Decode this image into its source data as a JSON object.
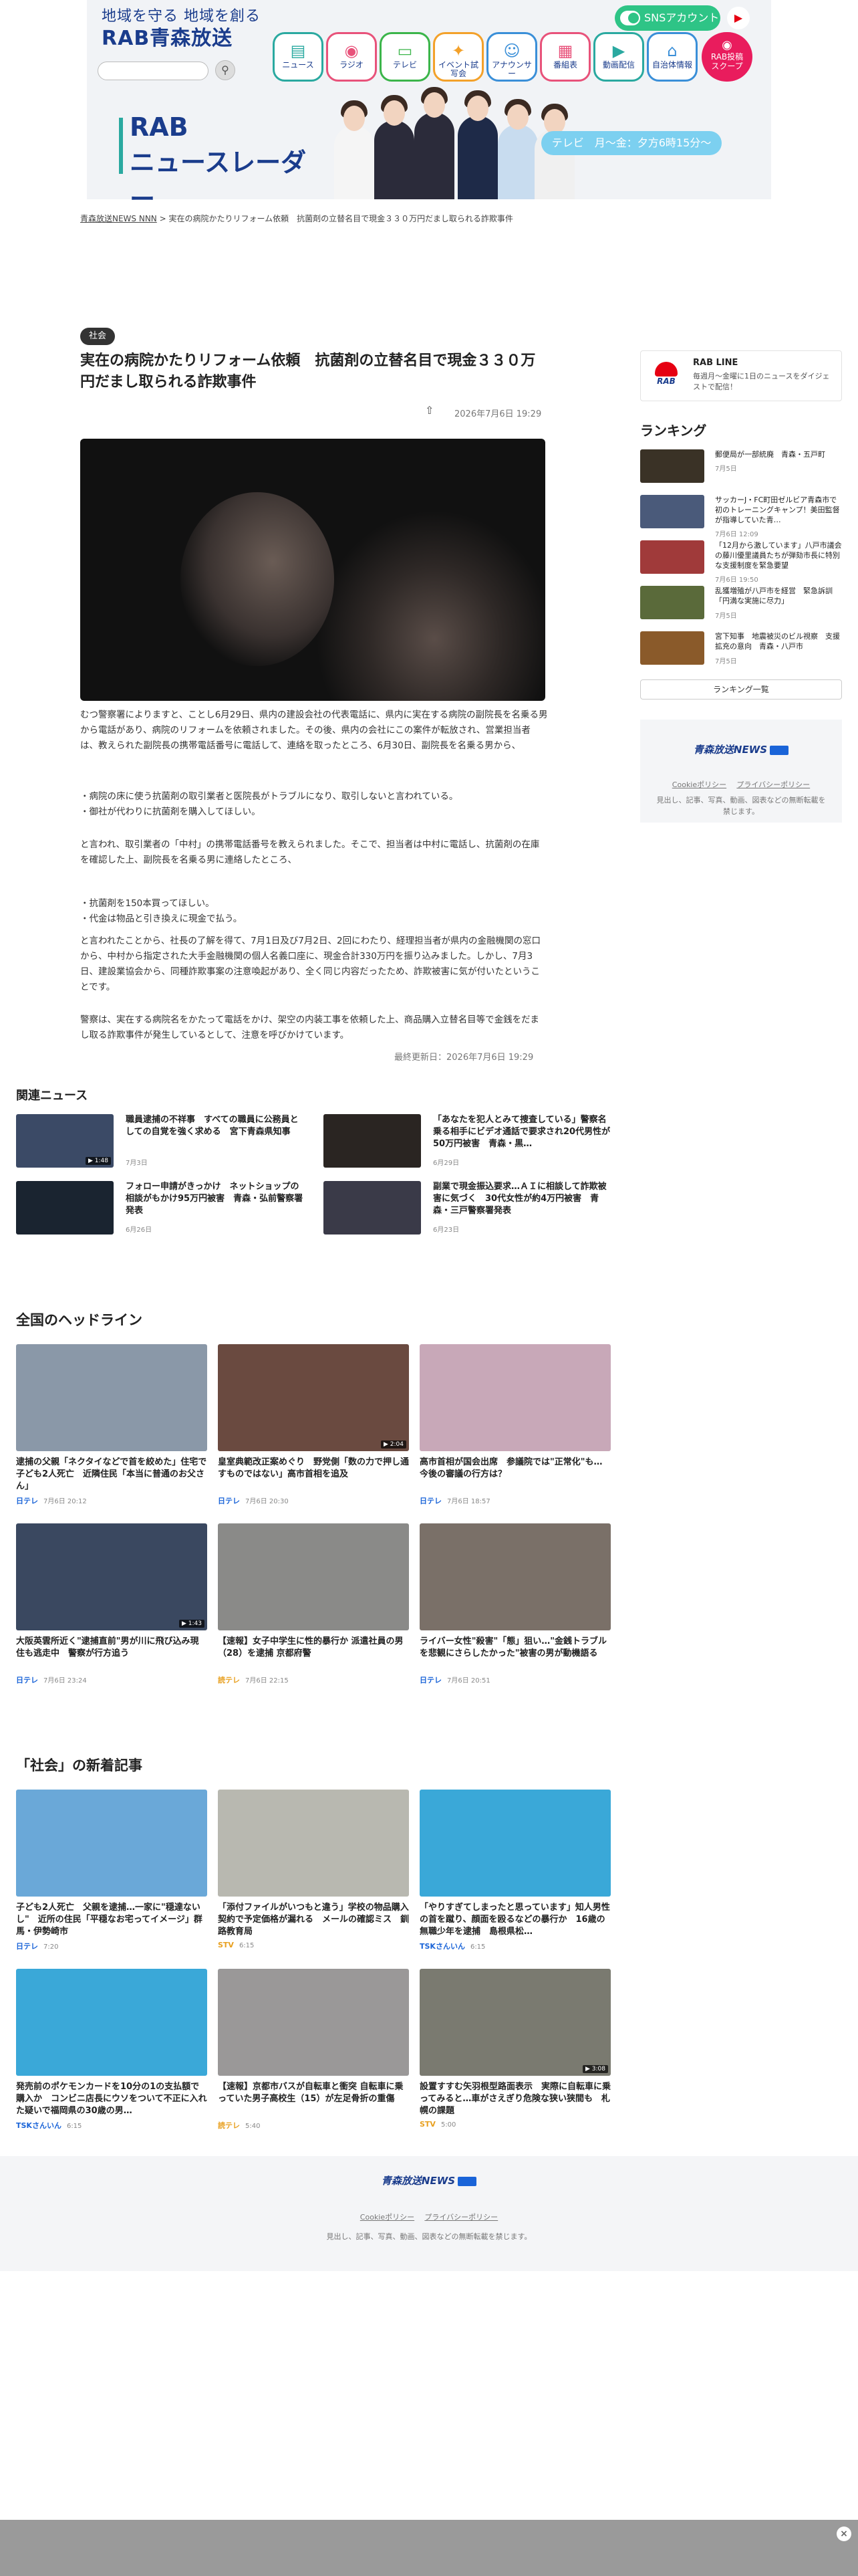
{
  "header": {
    "tagline": "地域を守る 地域を創る",
    "brand": "RAB青森放送",
    "sns_label": "SNSアカウント",
    "nav": [
      {
        "label": "ニュース",
        "icon": "newspaper-icon",
        "color": "#2aa9a0"
      },
      {
        "label": "ラジオ",
        "icon": "radio-icon",
        "color": "#e8527a"
      },
      {
        "label": "テレビ",
        "icon": "tv-icon",
        "color": "#3bb54a"
      },
      {
        "label": "イベント試写会",
        "icon": "ticket-icon",
        "color": "#f3a12a"
      },
      {
        "label": "アナウンサー",
        "icon": "announcer-icon",
        "color": "#3a8fd8"
      },
      {
        "label": "番組表",
        "icon": "calendar-icon",
        "color": "#e8527a"
      },
      {
        "label": "動画配信",
        "icon": "video-icon",
        "color": "#2aa9a0"
      },
      {
        "label": "自治体情報",
        "icon": "building-icon",
        "color": "#3a8fd8"
      }
    ],
    "scoop_label": "RAB投稿スクープ",
    "banner_line1": "RAB",
    "banner_line2": "ニュースレーダー",
    "onair": "テレビ　月〜金：夕方6時15分〜"
  },
  "breadcrumb": {
    "home": "青森放送NEWS NNN",
    "current": "実在の病院かたりリフォーム依頼　抗菌剤の立替名目で現金３３０万円だまし取られる詐欺事件"
  },
  "article": {
    "category": "社会",
    "title": "実在の病院かたりリフォーム依頼　抗菌剤の立替名目で現金３３０万円だまし取られる詐欺事件",
    "date": "2026年7月6日 19:29",
    "paragraphs": [
      "むつ警察署によりますと、ことし6月29日、県内の建設会社の代表電話に、県内に実在する病院の副院長を名乗る男から電話があり、病院のリフォームを依頼されました。その後、県内の会社にこの案件が転放され、営業担当者は、教えられた副院長の携帯電話番号に電話して、連絡を取ったところ、6月30日、副院長を名乗る男から、",
      "・病院の床に使う抗菌剤の取引業者と医院長がトラブルになり、取引しないと言われている。\n・御社が代わりに抗菌剤を購入してほしい。",
      "と言われ、取引業者の「中村」の携帯電話番号を教えられました。そこで、担当者は中村に電話し、抗菌剤の在庫を確認した上、副院長を名乗る男に連絡したところ、",
      "・抗菌剤を150本買ってほしい。\n・代金は物品と引き換えに現金で払う。",
      "と言われたことから、社長の了解を得て、7月1日及び7月2日、2回にわたり、経理担当者が県内の金融機関の窓口から、中村から指定された大手金融機関の個人名義口座に、現金合計330万円を振り込みました。しかし、7月3日、建設業協会から、同種詐欺事案の注意喚起があり、全く同じ内容だったため、詐欺被害に気が付いたということです。",
      "警察は、実在する病院名をかたって電話をかけ、架空の内装工事を依頼した上、商品購入立替名目等で金銭をだまし取る詐欺事件が発生しているとして、注意を呼びかけています。"
    ],
    "updated": "最終更新日：2026年7月6日 19:29"
  },
  "sidebar": {
    "line_title": "RAB LINE",
    "line_desc": "毎週月〜金曜に1日のニュースをダイジェストで配信！",
    "ranking_title": "ランキング",
    "ranking": [
      {
        "title": "郵便局が一部統廃　青森・五戸町",
        "date": "7月5日",
        "color": "#3a3226"
      },
      {
        "title": "サッカーJ・FC町田ゼルビア青森市で初のトレーニングキャンプ！美田監督が指導していた青…",
        "date": "7月6日 12:09",
        "color": "#4a5a7a"
      },
      {
        "title": "「12月から激しています」八戸市議会の藤川優里議員たちが弾劾市長に特別な支援制度を緊急要望",
        "date": "7月6日 19:50",
        "color": "#a03a3a"
      },
      {
        "title": "乱獲増殖が八戸市を経営　緊急訴訓「円満な実施に尽力」",
        "date": "7月5日",
        "color": "#5a6a3a"
      },
      {
        "title": "宮下知事　地震被災のビル視察　支援拡充の意向　青森・八戸市",
        "date": "7月5日",
        "color": "#8a5a2a"
      }
    ],
    "ranking_more": "ランキング一覧",
    "foot_brand": "青森放送NEWS",
    "cookie": "Cookieポリシー",
    "privacy": "プライバシーポリシー",
    "copyright": "見出し、記事、写真、動画、図表などの無断転載を禁じます。"
  },
  "related": {
    "title": "関連ニュース",
    "items": [
      {
        "title": "職員逮捕の不祥事　すべての職員に公務員としての自覚を強く求める　宮下青森県知事",
        "date": "7月3日",
        "color": "#3b4a66",
        "video": "▶ 1:48"
      },
      {
        "title": "「あなたを犯人とみて捜査している」警察名乗る相手にビデオ通話で要求され20代男性が50万円被害　青森・黒…",
        "date": "6月29日",
        "color": "#2a2522",
        "video": ""
      },
      {
        "title": "フォロー申請がきっかけ　ネットショップの相談がもかけ95万円被害　青森・弘前警察署発表",
        "date": "6月26日",
        "color": "#1a2430",
        "video": ""
      },
      {
        "title": "副業で現金振込要求…ＡＩに相談して詐欺被害に気づく　30代女性が約4万円被害　青森・三戸警察署発表",
        "date": "6月23日",
        "color": "#3a3a48",
        "video": ""
      }
    ]
  },
  "national": {
    "title": "全国のヘッドライン",
    "items": [
      {
        "title": "逮捕の父親「ネクタイなどで首を絞めた」住宅で子ども2人死亡　近隣住民「本当に普通のお父さん」",
        "src": "日テレ",
        "date": "7月6日 20:12",
        "color": "#8a98a8",
        "video": "",
        "src_color": "#1a64d8"
      },
      {
        "title": "皇室典範改正案めぐり　野党側「数の力で押し通すものではない」高市首相を追及",
        "src": "日テレ",
        "date": "7月6日 20:30",
        "color": "#6a4a40",
        "video": "▶ 2:04",
        "src_color": "#1a64d8"
      },
      {
        "title": "高市首相が国会出席　参議院では\"正常化\"も…今後の審議の行方は？",
        "src": "日テレ",
        "date": "7月6日 18:57",
        "color": "#c8a8b8",
        "video": "",
        "src_color": "#1a64d8"
      },
      {
        "title": "大阪英雲所近く\"逮捕直前\"男が川に飛び込み現住も逃走中　警察が行方追う",
        "src": "日テレ",
        "date": "7月6日 23:24",
        "color": "#3a4860",
        "video": "▶ 1:43",
        "src_color": "#1a64d8"
      },
      {
        "title": "【速報】女子中学生に性的暴行か 派遣社員の男（28）を逮捕 京都府警",
        "src": "読テレ",
        "date": "7月6日 22:15",
        "color": "#8a8a88",
        "video": "",
        "src_color": "#e8a020"
      },
      {
        "title": "ライバー女性\"殺害\"「態」狙い…\"金銭トラブルを悲観にさらしたかった\"被害の男が動機語る",
        "src": "日テレ",
        "date": "7月6日 20:51",
        "color": "#7a7068",
        "video": "",
        "src_color": "#1a64d8"
      }
    ]
  },
  "society": {
    "title": "「社会」の新着記事",
    "items": [
      {
        "title": "子ども2人死亡　父親を逮捕…一家に\"穏達ないし\"　近所の住民「平穏なお宅ってイメージ」群馬・伊勢崎市",
        "src": "日テレ",
        "date": "7:20",
        "color": "#6aa8d8",
        "video": "",
        "src_color": "#1a64d8"
      },
      {
        "title": "「添付ファイルがいつもと違う」学校の物品購入契約で予定価格が漏れる　メールの確認ミス　釧路教育局",
        "src": "STV",
        "date": "6:15",
        "color": "#b8b8b0",
        "video": "",
        "src_color": "#e8a020"
      },
      {
        "title": "「やりすぎてしまったと思っています」知人男性の首を蹴り、顔面を殴るなどの暴行か　16歳の無職少年を逮捕　島根県松…",
        "src": "TSKさんいん",
        "date": "6:15",
        "color": "#3aa8d8",
        "video": "",
        "src_color": "#1a64d8"
      },
      {
        "title": "発売前のポケモンカードを10分の1の支払額で購入か　コンビニ店長にウソをついて不正に入れた疑いで福岡県の30歳の男…",
        "src": "TSKさんいん",
        "date": "6:15",
        "color": "#3aa8d8",
        "video": "",
        "src_color": "#1a64d8"
      },
      {
        "title": "【速報】京都市バスが自転車と衝突 自転車に乗っていた男子高校生（15）が左足骨折の重傷",
        "src": "読テレ",
        "date": "5:40",
        "color": "#9a9898",
        "video": "",
        "src_color": "#e8a020"
      },
      {
        "title": "設置すすむ矢羽根型路面表示　実際に自転車に乗ってみると…車がさえぎり危険な狭い狭間も　札幌の課題",
        "src": "STV",
        "date": "5:00",
        "color": "#7a7a70",
        "video": "▶ 3:08",
        "src_color": "#e8a020"
      }
    ]
  },
  "footer": {
    "brand": "青森放送NEWS",
    "cookie": "Cookieポリシー",
    "privacy": "プライバシーポリシー",
    "copyright": "見出し、記事、写真、動画、図表などの無断転載を禁じます。"
  }
}
